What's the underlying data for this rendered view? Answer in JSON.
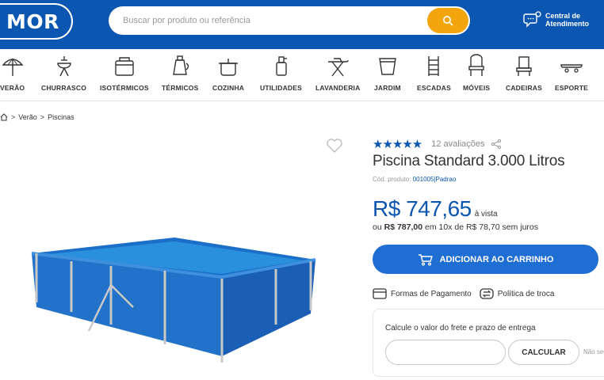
{
  "header": {
    "logo_text": "MOR",
    "search_placeholder": "Buscar por produto ou referência",
    "help_line1": "Central de",
    "help_line2": "Atendimento",
    "brand_color": "#0b56b0",
    "accent_color": "#f2a50c"
  },
  "categories": [
    {
      "label": "VERÃO",
      "icon": "umbrella-icon"
    },
    {
      "label": "CHURRASCO",
      "icon": "grill-icon"
    },
    {
      "label": "ISOTÉRMICOS",
      "icon": "cooler-icon"
    },
    {
      "label": "TÉRMICOS",
      "icon": "thermos-icon"
    },
    {
      "label": "COZINHA",
      "icon": "pot-icon"
    },
    {
      "label": "UTILIDADES",
      "icon": "spray-bottle-icon"
    },
    {
      "label": "LAVANDERIA",
      "icon": "ironing-board-icon"
    },
    {
      "label": "JARDIM",
      "icon": "flower-pot-icon"
    },
    {
      "label": "ESCADAS",
      "icon": "ladder-icon"
    },
    {
      "label": "MÓVEIS",
      "icon": "chair-icon"
    },
    {
      "label": "CADEIRAS",
      "icon": "beach-chair-icon"
    },
    {
      "label": "ESPORTE",
      "icon": "skateboard-icon"
    }
  ],
  "breadcrumb": {
    "items": [
      "Verão",
      "Piscinas"
    ]
  },
  "product": {
    "rating_stars": 5,
    "reviews": "12 avaliações",
    "title": "Piscina Standard 3.000 Litros",
    "sku_label": "Cód. produto:",
    "sku_value": "001005|Padrao",
    "price": "R$ 747,65",
    "price_suffix": "à vista",
    "install_prefix": "ou",
    "install_full": "R$ 787,00",
    "install_rest": "em 10x de R$ 78,70 sem juros",
    "cart_label": "ADICIONAR AO CARRINHO",
    "payment_link": "Formas de Pagamento",
    "exchange_link": "Política de troca"
  },
  "freight": {
    "title": "Calcule o valor do frete e prazo de entrega",
    "calc_label": "CALCULAR",
    "unknown_cep": "Não sei"
  }
}
